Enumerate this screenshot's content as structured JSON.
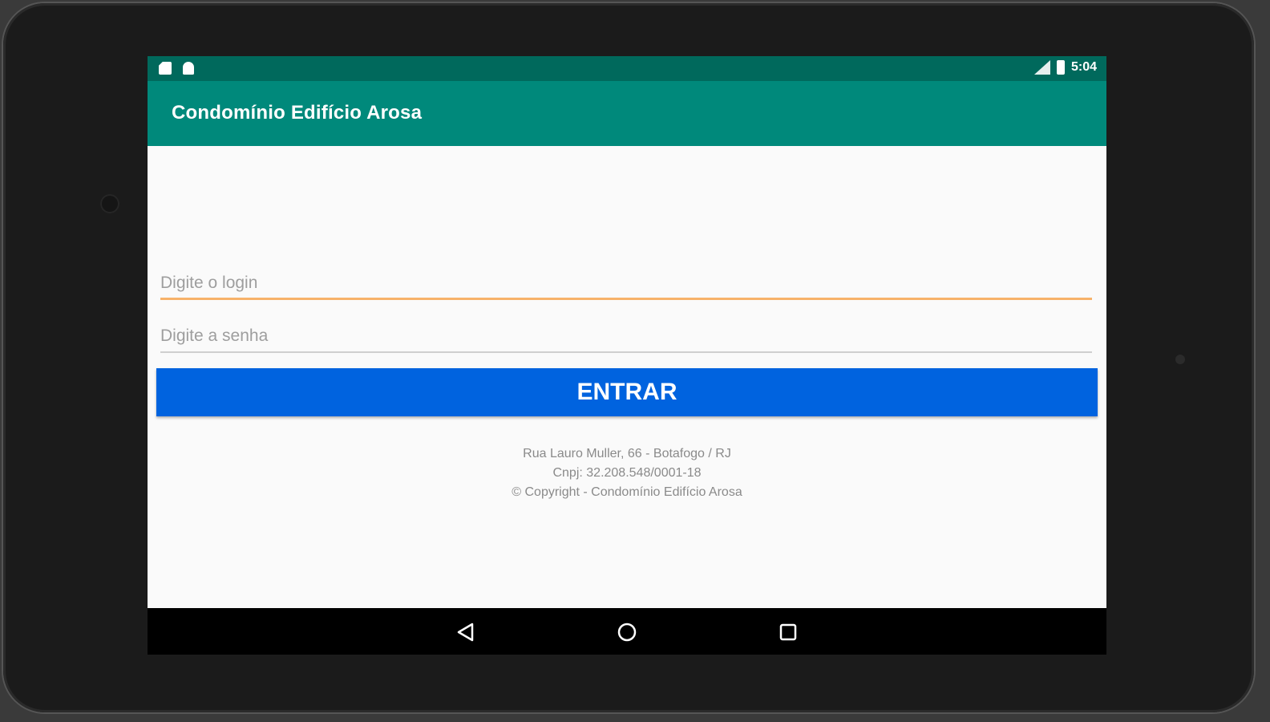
{
  "status_bar": {
    "time": "5:04",
    "left_icons": [
      "sd-card-icon",
      "android-icon"
    ],
    "right_icons": [
      "signal-icon",
      "battery-icon"
    ]
  },
  "app_bar": {
    "title": "Condomínio Edifício Arosa"
  },
  "form": {
    "login": {
      "placeholder": "Digite o login",
      "value": ""
    },
    "password": {
      "placeholder": "Digite a senha",
      "value": ""
    },
    "submit_label": "ENTRAR"
  },
  "footer": {
    "address": "Rua Lauro Muller, 66 - Botafogo / RJ",
    "cnpj": "Cnpj: 32.208.548/0001-18",
    "copyright": "© Copyright - Condomínio Edifício Arosa"
  },
  "nav_bar": {
    "buttons": [
      "back-icon",
      "home-icon",
      "recents-icon"
    ]
  },
  "colors": {
    "status_bar": "#00695c",
    "app_bar": "#00897b",
    "button": "#0063df",
    "focused_underline": "#f7b26a"
  }
}
